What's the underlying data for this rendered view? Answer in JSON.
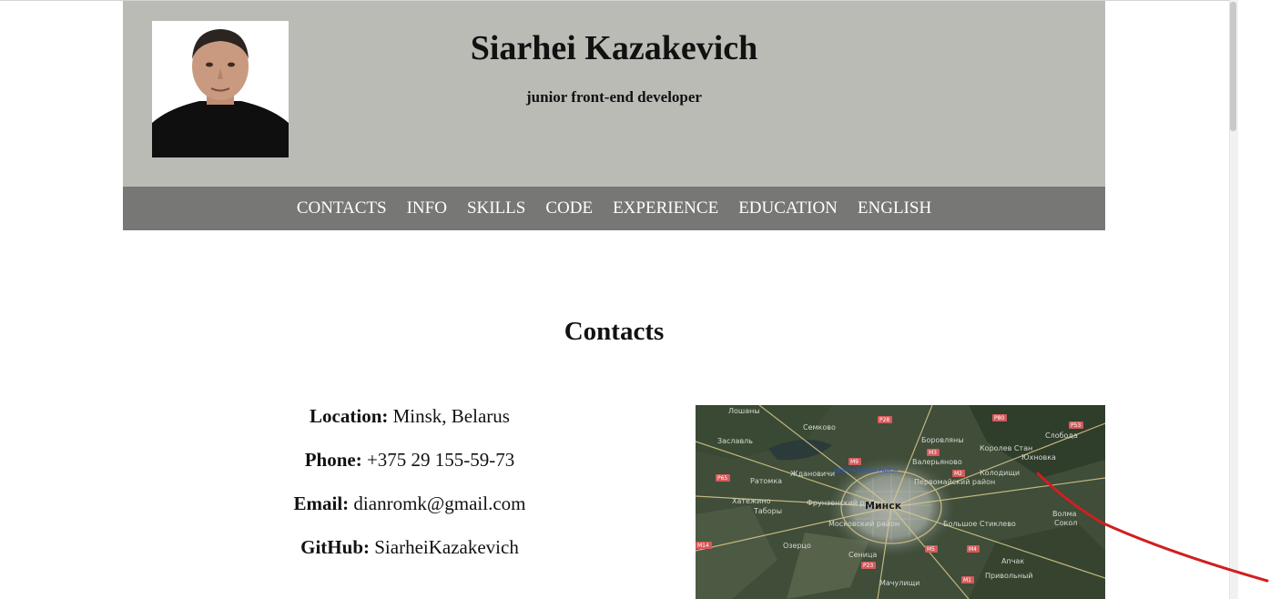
{
  "header": {
    "name": "Siarhei Kazakevich",
    "role": "junior front-end developer"
  },
  "nav": {
    "items": [
      {
        "label": "CONTACTS"
      },
      {
        "label": "INFO"
      },
      {
        "label": "SKILLS"
      },
      {
        "label": "CODE"
      },
      {
        "label": "EXPERIENCE"
      },
      {
        "label": "EDUCATION"
      },
      {
        "label": "ENGLISH"
      }
    ]
  },
  "contacts": {
    "title": "Contacts",
    "location_key": "Location:",
    "location_value": "Minsk, Belarus",
    "phone_key": "Phone:",
    "phone_value": "+375 29 155-59-73",
    "email_key": "Email:",
    "email_value": "dianromk@gmail.com",
    "github_key": "GitHub:",
    "github_value": "SiarheiKazakevich"
  },
  "map": {
    "labels": {
      "city": "Минск",
      "central": "ЦЕНТРАЛЬНЫЙ РАЙОН",
      "l1": "Лошаны",
      "l2": "Семково",
      "l3": "Боровляны",
      "l4": "Заславль",
      "l5": "Валерьяново",
      "l6": "Королев Стан",
      "l7": "Юхновка",
      "l8": "Колодищи",
      "l9": "Ратомка",
      "l10": "Ждановичи",
      "l11": "Хатежино",
      "l12": "Таборы",
      "l13": "Фрунзенский район",
      "l14": "Московский район",
      "l15": "Первомайский район",
      "l16": "Большое Стиклево",
      "l17": "Озерцо",
      "l18": "Сеница",
      "l19": "Мачулищи",
      "l20": "Привольный",
      "l21": "Волма",
      "l22": "Сокол",
      "l23": "Апчак",
      "l24": "Слобода"
    },
    "roads": [
      "P28",
      "M9",
      "P80",
      "P53",
      "P65",
      "M3",
      "M2",
      "P23",
      "M14",
      "M4",
      "M1",
      "M5"
    ]
  },
  "colors": {
    "header_bg": "#babbb5",
    "nav_bg": "#777775",
    "annotation": "#d01f1f"
  }
}
